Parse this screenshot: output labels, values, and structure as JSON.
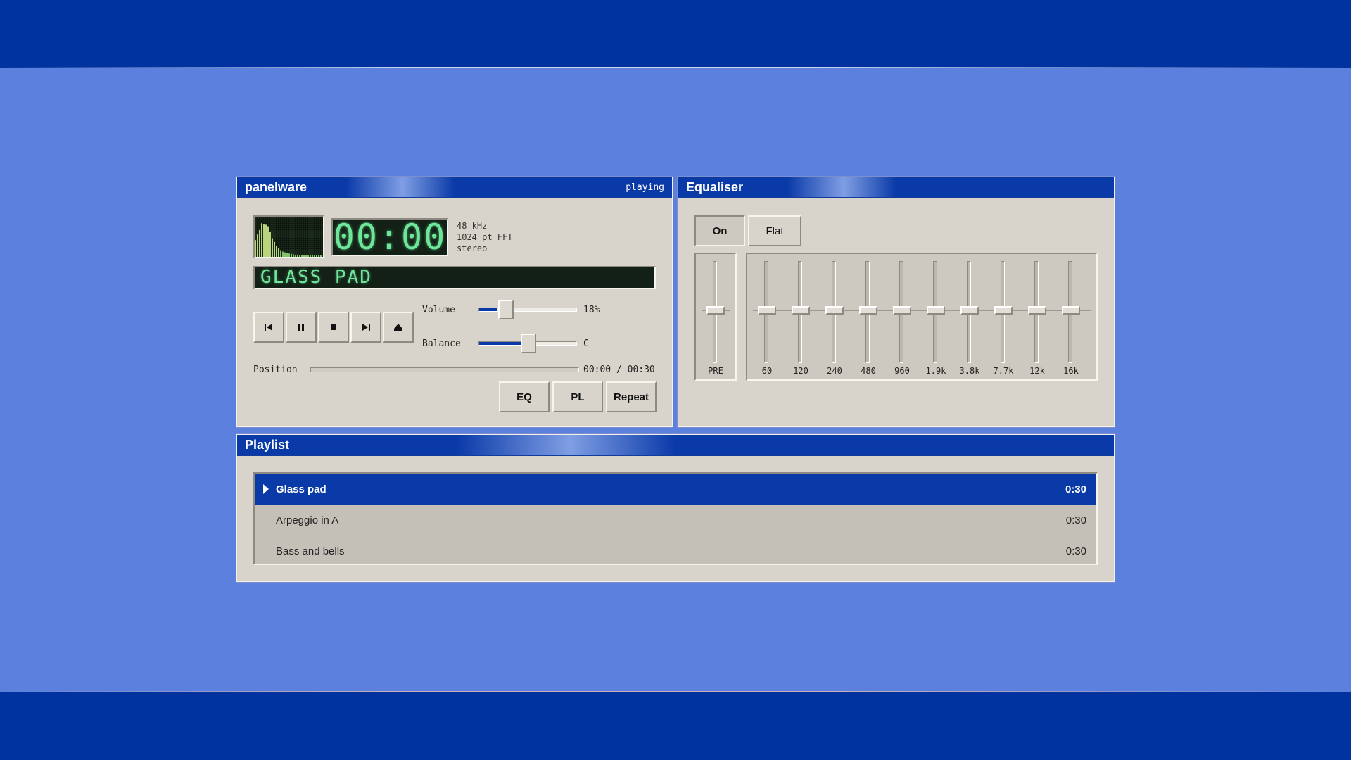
{
  "player": {
    "title": "panelware",
    "status": "playing",
    "time": "00:00",
    "info": [
      "48 kHz",
      "1024 pt FFT",
      "stereo"
    ],
    "track_display": "GLASS PAD",
    "transport": {
      "prev_icon": "skip-previous-icon",
      "pause_icon": "pause-icon",
      "stop_icon": "stop-icon",
      "next_icon": "skip-next-icon",
      "eject_icon": "eject-icon"
    },
    "volume": {
      "label": "Volume",
      "value": 18,
      "display": "18%"
    },
    "balance": {
      "label": "Balance",
      "value": 0,
      "display": "C"
    },
    "position": {
      "label": "Position",
      "value": 0,
      "display": "00:00 / 00:30"
    },
    "buttons": {
      "eq": "EQ",
      "pl": "PL",
      "repeat": "Repeat"
    },
    "spectrum": [
      0.45,
      0.6,
      0.72,
      0.9,
      0.88,
      0.86,
      0.82,
      0.66,
      0.5,
      0.4,
      0.3,
      0.24,
      0.18,
      0.14,
      0.12,
      0.1,
      0.09,
      0.08,
      0.07,
      0.06,
      0.06,
      0.05,
      0.05,
      0.05,
      0.04,
      0.04,
      0.04,
      0.04,
      0.03,
      0.03,
      0.03,
      0.03
    ]
  },
  "equaliser": {
    "title": "Equaliser",
    "on_label": "On",
    "flat_label": "Flat",
    "preamp": {
      "label": "PRE",
      "value": 0
    },
    "bands": [
      {
        "label": "60",
        "value": 0
      },
      {
        "label": "120",
        "value": 0
      },
      {
        "label": "240",
        "value": 0
      },
      {
        "label": "480",
        "value": 0
      },
      {
        "label": "960",
        "value": 0
      },
      {
        "label": "1.9k",
        "value": 0
      },
      {
        "label": "3.8k",
        "value": 0
      },
      {
        "label": "7.7k",
        "value": 0
      },
      {
        "label": "12k",
        "value": 0
      },
      {
        "label": "16k",
        "value": 0
      }
    ]
  },
  "playlist": {
    "title": "Playlist",
    "items": [
      {
        "name": "Glass pad",
        "duration": "0:30",
        "active": true
      },
      {
        "name": "Arpeggio in A",
        "duration": "0:30",
        "active": false
      },
      {
        "name": "Bass and bells",
        "duration": "0:30",
        "active": false
      }
    ]
  },
  "colors": {
    "accent": "#0a3aa8",
    "background": "#5b80dd",
    "panel": "#d8d4cb",
    "lcd": "#6ee69a"
  }
}
